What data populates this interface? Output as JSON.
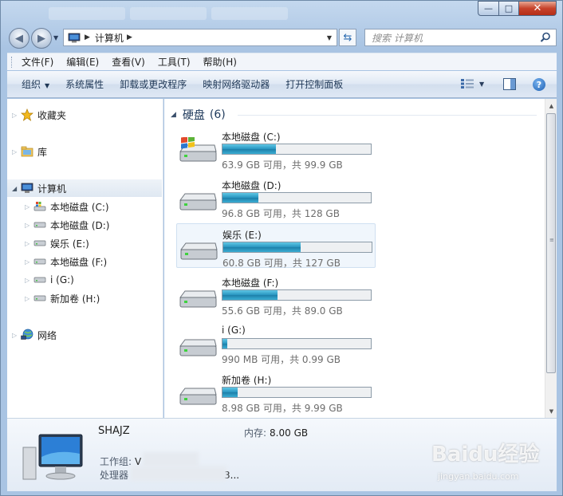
{
  "window": {
    "controls": {
      "minimize": "—",
      "maximize": "□",
      "close": "✕"
    }
  },
  "address": {
    "path": "计算机",
    "search_placeholder": "搜索 计算机"
  },
  "menu": [
    "文件(F)",
    "编辑(E)",
    "查看(V)",
    "工具(T)",
    "帮助(H)"
  ],
  "toolbar": {
    "organize": "组织",
    "system_properties": "系统属性",
    "uninstall": "卸载或更改程序",
    "map_drive": "映射网络驱动器",
    "control_panel": "打开控制面板"
  },
  "nav": {
    "favorites": "收藏夹",
    "libraries": "库",
    "computer": "计算机",
    "drives": [
      "本地磁盘 (C:)",
      "本地磁盘 (D:)",
      "娱乐 (E:)",
      "本地磁盘 (F:)",
      "i (G:)",
      "新加卷 (H:)"
    ],
    "network": "网络"
  },
  "content": {
    "group_title": "硬盘",
    "group_count": "(6)",
    "drives": [
      {
        "name": "本地磁盘 (C:)",
        "info": "63.9 GB 可用，共 99.9 GB",
        "used_fraction": 0.36,
        "system": true
      },
      {
        "name": "本地磁盘 (D:)",
        "info": "96.8 GB 可用，共 128 GB",
        "used_fraction": 0.24
      },
      {
        "name": "娱乐 (E:)",
        "info": "60.8 GB 可用，共 127 GB",
        "used_fraction": 0.52
      },
      {
        "name": "本地磁盘 (F:)",
        "info": "55.6 GB 可用，共 89.0 GB",
        "used_fraction": 0.37
      },
      {
        "name": "i (G:)",
        "info": "990 MB 可用，共 0.99 GB",
        "used_fraction": 0.03
      },
      {
        "name": "新加卷 (H:)",
        "info": "8.98 GB 可用，共 9.99 GB",
        "used_fraction": 0.1
      }
    ]
  },
  "details": {
    "pc_name": "SHAJZ",
    "memory_label": "内存:",
    "memory_value": "8.00 GB",
    "workgroup_label": "工作组:",
    "workgroup_value": "V",
    "processor_label": "处理器",
    "processor_value": "3..."
  },
  "watermark": {
    "text": "Baidu经验",
    "sub": "jingyan.baidu.com"
  }
}
